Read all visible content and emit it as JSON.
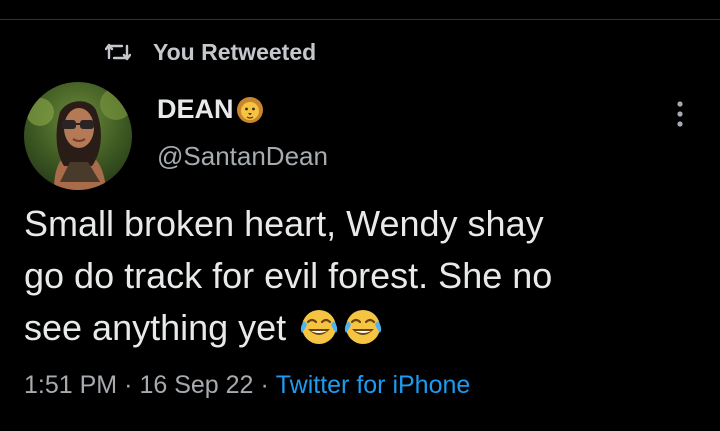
{
  "retweet": {
    "icon": "retweet-icon",
    "label": "You Retweeted"
  },
  "author": {
    "name": "DEAN",
    "name_emoji_icon": "lion-face-icon",
    "handle": "@SantanDean",
    "avatar_icon": "profile-avatar"
  },
  "menu": {
    "icon": "more-vertical-icon"
  },
  "tweet": {
    "lines": [
      "Small broken heart, Wendy shay",
      "go do track for evil forest. She no",
      "see anything yet"
    ],
    "trailing_emoji_icon": "face-with-tears-of-joy-icon"
  },
  "meta": {
    "time": "1:51 PM",
    "separator": "·",
    "date": "16 Sep 22",
    "source": "Twitter for iPhone"
  },
  "colors": {
    "background": "#000000",
    "primary_text": "#e7e9ea",
    "secondary_text": "#a6abb0",
    "link": "#1d9bf0",
    "emoji_yellow": "#f6c443"
  }
}
